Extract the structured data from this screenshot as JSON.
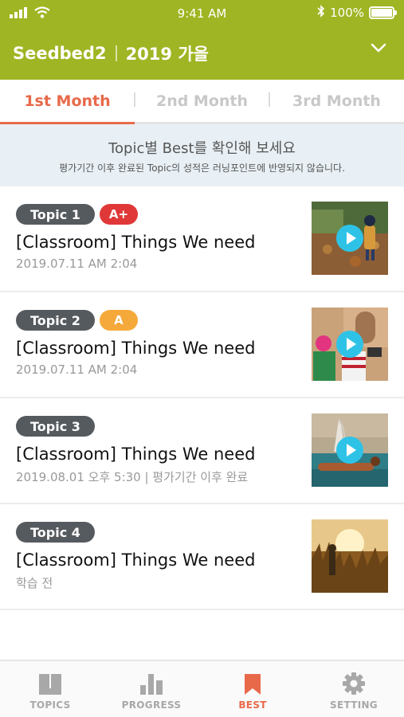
{
  "status_bar": {
    "time": "9:41 AM",
    "battery": "100%",
    "icons": [
      "signal-icon",
      "wifi-icon",
      "bluetooth-icon",
      "battery-icon"
    ]
  },
  "header": {
    "app_name": "Seedbed2",
    "term": "2019 가을",
    "dropdown_icon": "chevron-down-icon"
  },
  "tabs": [
    {
      "label": "1st Month",
      "active": true
    },
    {
      "label": "2nd Month",
      "active": false
    },
    {
      "label": "3rd Month",
      "active": false
    }
  ],
  "notice": {
    "title": "Topic별 Best를 확인해 보세요",
    "subtitle": "평가기간 이후 완료된 Topic의 성적은 러닝포인트에 반영되지 않습니다."
  },
  "items": [
    {
      "topic": "Topic 1",
      "grade": "A+",
      "title": "[Classroom] Things We need",
      "meta": "2019.07.11 AM 2:04",
      "thumbnail": "autumn-child-photo"
    },
    {
      "topic": "Topic 2",
      "grade": "A",
      "title": "[Classroom] Things We need",
      "meta": "2019.07.11 AM 2:04",
      "thumbnail": "children-taking-photo"
    },
    {
      "topic": "Topic 3",
      "grade": "",
      "title": "[Classroom] Things We need",
      "meta": "2019.08.01 오후 5:30  |  평가기간 이후 완료",
      "thumbnail": "sea-tower-photo"
    },
    {
      "topic": "Topic 4",
      "grade": "",
      "title": "[Classroom] Things We need",
      "meta": "학습 전",
      "thumbnail": "sunset-field-photo"
    }
  ],
  "bottom_nav": [
    {
      "label": "TOPICS",
      "icon": "book-icon",
      "active": false
    },
    {
      "label": "PROGRESS",
      "icon": "bar-chart-icon",
      "active": false
    },
    {
      "label": "BEST",
      "icon": "bookmark-icon",
      "active": true
    },
    {
      "label": "SETTING",
      "icon": "gear-icon",
      "active": false
    }
  ],
  "colors": {
    "brand": "#a0b523",
    "accent": "#e8694a",
    "grade_a_plus": "#e03838",
    "grade_a": "#f5a93a",
    "play": "#2ec3e6"
  }
}
